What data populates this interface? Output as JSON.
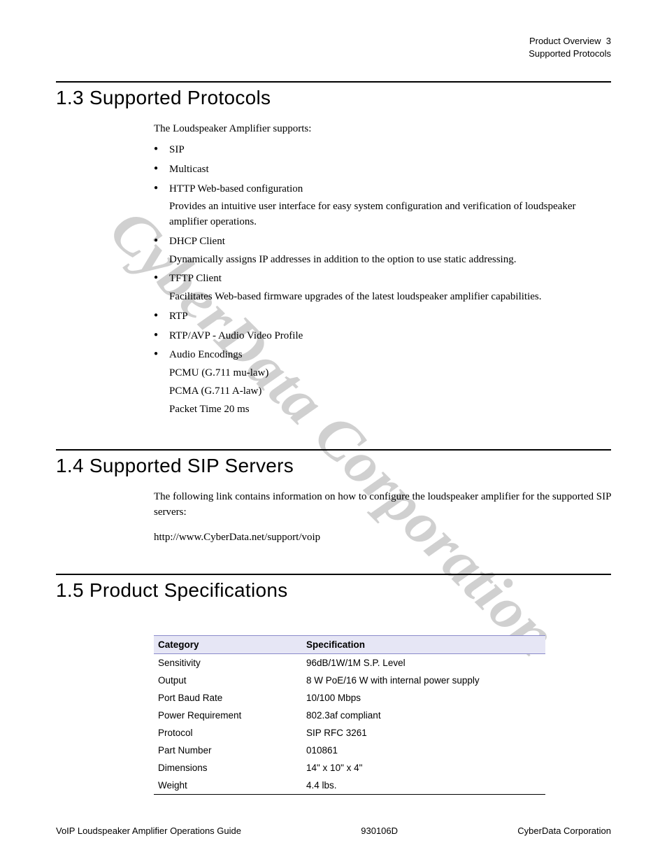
{
  "runningHead": {
    "line1": "Product Overview",
    "pageNum": "3",
    "line2": "Supported Protocols"
  },
  "watermark": "CyberData Corporation",
  "sections": {
    "s13": {
      "title": "1.3 Supported Protocols",
      "intro": "The Loudspeaker Amplifier supports:",
      "items": [
        {
          "label": "SIP"
        },
        {
          "label": "Multicast"
        },
        {
          "label": "HTTP Web-based configuration",
          "desc": "Provides an intuitive user interface for easy system configuration and verification of loudspeaker amplifier operations."
        },
        {
          "label": "DHCP Client",
          "desc": "Dynamically assigns IP addresses in addition to the option to use static addressing."
        },
        {
          "label": "TFTP Client",
          "desc": "Facilitates Web-based firmware upgrades of the latest loudspeaker amplifier capabilities."
        },
        {
          "label": "RTP"
        },
        {
          "label": "RTP/AVP - Audio Video Profile"
        },
        {
          "label": "Audio Encodings",
          "lines": [
            "PCMU (G.711 mu-law)",
            "PCMA (G.711 A-law)",
            "Packet Time 20 ms"
          ]
        }
      ]
    },
    "s14": {
      "title": "1.4 Supported SIP Servers",
      "para": "The following link contains information on how to configure the loudspeaker amplifier for the supported SIP servers:",
      "link": "http://www.CyberData.net/support/voip"
    },
    "s15": {
      "title": "1.5 Product Specifications",
      "table": {
        "headers": [
          "Category",
          "Specification"
        ],
        "rows": [
          [
            "Sensitivity",
            "96dB/1W/1M S.P. Level"
          ],
          [
            "Output",
            "8 W PoE/16 W with internal power supply"
          ],
          [
            "Port Baud Rate",
            "10/100 Mbps"
          ],
          [
            "Power Requirement",
            "802.3af compliant"
          ],
          [
            "Protocol",
            "SIP RFC 3261"
          ],
          [
            "Part Number",
            "010861"
          ],
          [
            "Dimensions",
            "14\" x 10\" x 4\""
          ],
          [
            "Weight",
            "4.4 lbs."
          ]
        ]
      }
    }
  },
  "footer": {
    "left": "VoIP Loudspeaker Amplifier Operations Guide",
    "center": "930106D",
    "right": "CyberData Corporation"
  }
}
